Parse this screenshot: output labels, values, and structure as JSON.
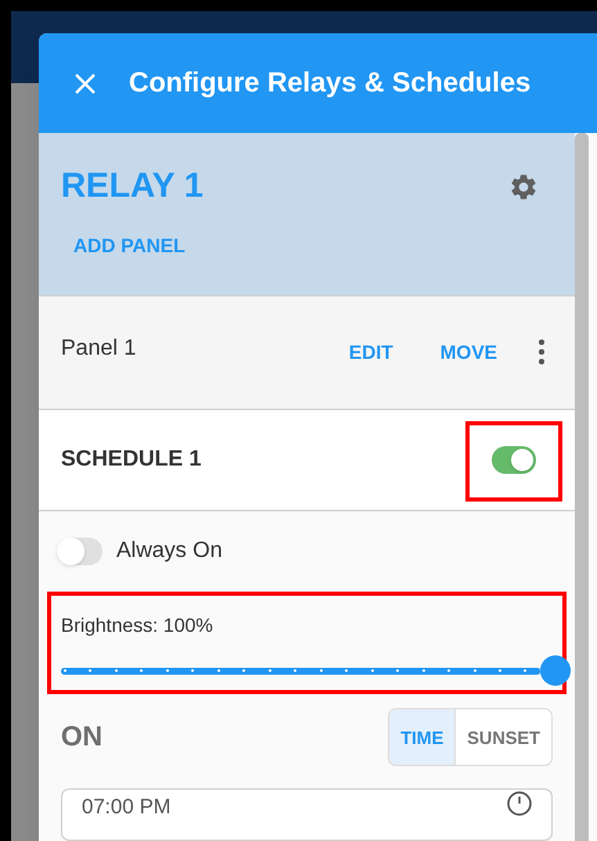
{
  "dialog": {
    "title": "Configure Relays & Schedules"
  },
  "relay": {
    "title": "RELAY 1",
    "add_panel": "ADD PANEL"
  },
  "panels": [
    {
      "name": "Panel 1",
      "actions": [
        "EDIT",
        "MOVE"
      ]
    }
  ],
  "schedule": {
    "title": "SCHEDULE 1",
    "on": true,
    "highlighted": true
  },
  "always_on": {
    "label": "Always On",
    "on": false
  },
  "brightness": {
    "label": "Brightness: 100%",
    "level": 1,
    "highlighted": true
  },
  "on_section": {
    "title": "ON",
    "modes": [
      {
        "label": "TIME",
        "selected": true
      },
      {
        "label": "SUNSET",
        "selected": false
      }
    ],
    "time": "07:00 PM"
  }
}
